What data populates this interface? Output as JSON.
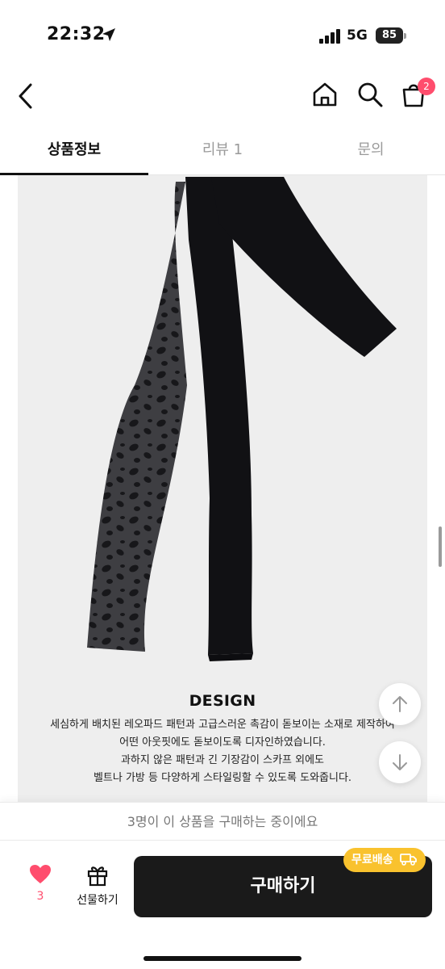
{
  "status_bar": {
    "time": "22:32",
    "network": "5G",
    "battery": "85"
  },
  "header": {
    "icons": [
      "back-icon",
      "home-icon",
      "search-icon",
      "cart-icon"
    ],
    "cart_count": "2"
  },
  "tabs": [
    {
      "label": "상품정보",
      "active": true
    },
    {
      "label": "리뷰 1",
      "active": false
    },
    {
      "label": "문의",
      "active": false
    }
  ],
  "content": {
    "heading": "DESIGN",
    "lines": [
      "세심하게 배치된 레오파드 패턴과 고급스러운 촉감이 돋보이는 소재로 제작하여",
      "어떤 아웃핏에도 돋보이도록 디자인하였습니다.",
      "과하지 않은 패턴과 긴 기장감이 스카프 외에도",
      "벨트나 가방 등 다양하게 스타일링할 수 있도록 도와줍니다."
    ]
  },
  "notice": "3명이 이 상품을 구매하는 중이에요",
  "bottom_bar": {
    "like_count": "3",
    "gift_label": "선물하기",
    "buy_label": "구매하기",
    "shipping_badge": "무료배송"
  },
  "colors": {
    "accent": "#ff4d6d",
    "shipping_badge": "#f9c22e",
    "buy_button": "#1a1a1a",
    "content_bg": "#eeeeee"
  }
}
